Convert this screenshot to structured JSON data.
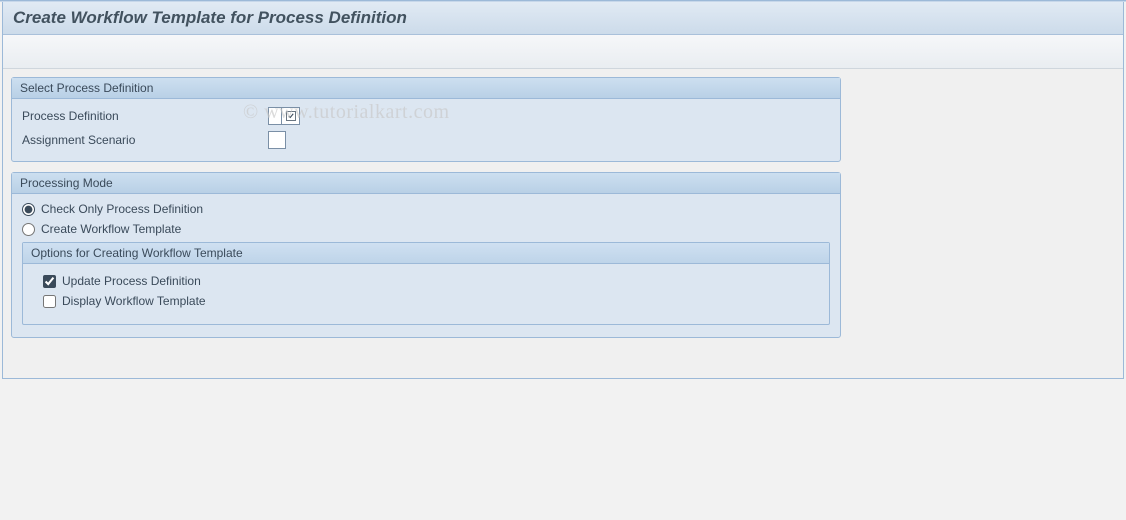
{
  "page": {
    "title": "Create Workflow Template for Process Definition"
  },
  "watermark": "© www.tutorialkart.com",
  "group1": {
    "title": "Select Process Definition",
    "processDefinition": {
      "label": "Process Definition",
      "value": ""
    },
    "assignmentScenario": {
      "label": "Assignment Scenario",
      "value": ""
    }
  },
  "group2": {
    "title": "Processing Mode",
    "radioCheckOnly": {
      "label": "Check Only Process Definition",
      "selected": true
    },
    "radioCreate": {
      "label": "Create Workflow Template",
      "selected": false
    },
    "subGroup": {
      "title": "Options for Creating Workflow Template",
      "chkUpdate": {
        "label": "Update Process Definition",
        "checked": true
      },
      "chkDisplay": {
        "label": "Display Workflow Template",
        "checked": false
      }
    }
  }
}
